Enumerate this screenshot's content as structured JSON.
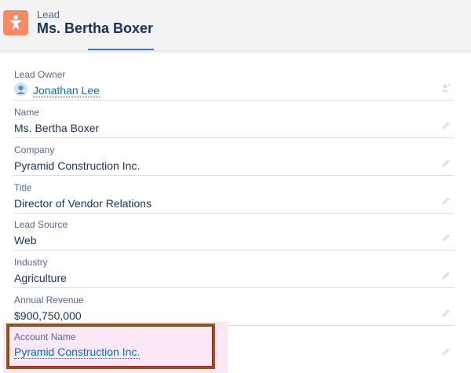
{
  "header": {
    "entity_label": "Lead",
    "record_title": "Ms. Bertha Boxer",
    "icon": "lead-person-icon",
    "icon_color": "#f88962"
  },
  "fields": {
    "lead_owner": {
      "label": "Lead Owner",
      "value": "Jonathan Lee",
      "icon": "change-owner-icon"
    },
    "name": {
      "label": "Name",
      "value": "Ms. Bertha Boxer"
    },
    "company": {
      "label": "Company",
      "value": "Pyramid Construction Inc."
    },
    "title": {
      "label": "Title",
      "value": "Director of Vendor Relations"
    },
    "lead_source": {
      "label": "Lead Source",
      "value": "Web"
    },
    "industry": {
      "label": "Industry",
      "value": "Agriculture"
    },
    "annual_revenue": {
      "label": "Annual Revenue",
      "value": "$900,750,000"
    },
    "account_name": {
      "label": "Account Name",
      "value": "Pyramid Construction Inc."
    }
  },
  "colors": {
    "link": "#0070d2",
    "highlight_border": "#8b5a14"
  }
}
